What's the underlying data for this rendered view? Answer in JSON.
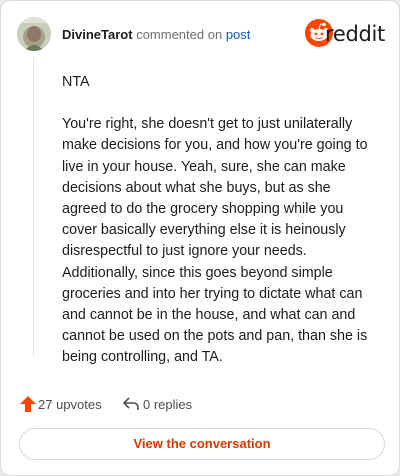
{
  "header": {
    "username": "DivineTarot",
    "action_text": "commented on",
    "post_link": "post",
    "brand_name": "reddit"
  },
  "comment": {
    "paragraphs": [
      "NTA",
      "You're right, she doesn't get to just unilaterally make decisions for you, and how you're going to live in your house. Yeah, sure, she can make decisions about what she buys, but as she agreed to do the grocery shopping while you cover basically everything else it is heinously disrespectful to just ignore your needs. Additionally, since this goes beyond simple groceries and into her trying to dictate what can and cannot be in the house, and what can and cannot be used on the pots and pan, than she is being controlling, and TA."
    ]
  },
  "actions": {
    "upvotes_label": "27 upvotes",
    "replies_label": "0 replies"
  },
  "cta": {
    "label": "View the conversation"
  },
  "colors": {
    "brand": "#ff4500",
    "link": "#0a59c9",
    "cta_text": "#d93a00"
  },
  "icons": {
    "upvote": "upvote-arrow-icon",
    "reply": "reply-arrow-icon",
    "logo": "reddit-snoo-icon"
  }
}
